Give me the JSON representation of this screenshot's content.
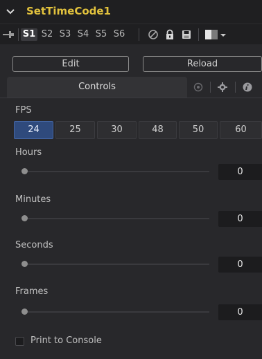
{
  "tool": {
    "name": "SetTimeCode1"
  },
  "toolbar": {
    "slots": [
      "S1",
      "S2",
      "S3",
      "S4",
      "S5",
      "S6"
    ],
    "active_slot": "S1"
  },
  "actions": {
    "edit_label": "Edit",
    "reload_label": "Reload"
  },
  "tabs": {
    "controls_label": "Controls"
  },
  "fps": {
    "label": "FPS",
    "options": [
      "24",
      "25",
      "30",
      "48",
      "50",
      "60"
    ],
    "selected": "24"
  },
  "fields": {
    "hours": {
      "label": "Hours",
      "value": "0"
    },
    "minutes": {
      "label": "Minutes",
      "value": "0"
    },
    "seconds": {
      "label": "Seconds",
      "value": "0"
    },
    "frames": {
      "label": "Frames",
      "value": "0"
    }
  },
  "print_to_console": {
    "label": "Print to Console",
    "checked": false
  },
  "colors": {
    "title": "#e2c23d",
    "selected_fps": "#2f4a7c",
    "background": "#28282b"
  },
  "icons": [
    "chevron-down-icon",
    "pin-icon",
    "bypass-icon",
    "lock-icon",
    "save-icon",
    "color-swatch-icon",
    "dropdown-arrow-icon",
    "settings-node-icon",
    "gear-icon",
    "info-icon"
  ]
}
